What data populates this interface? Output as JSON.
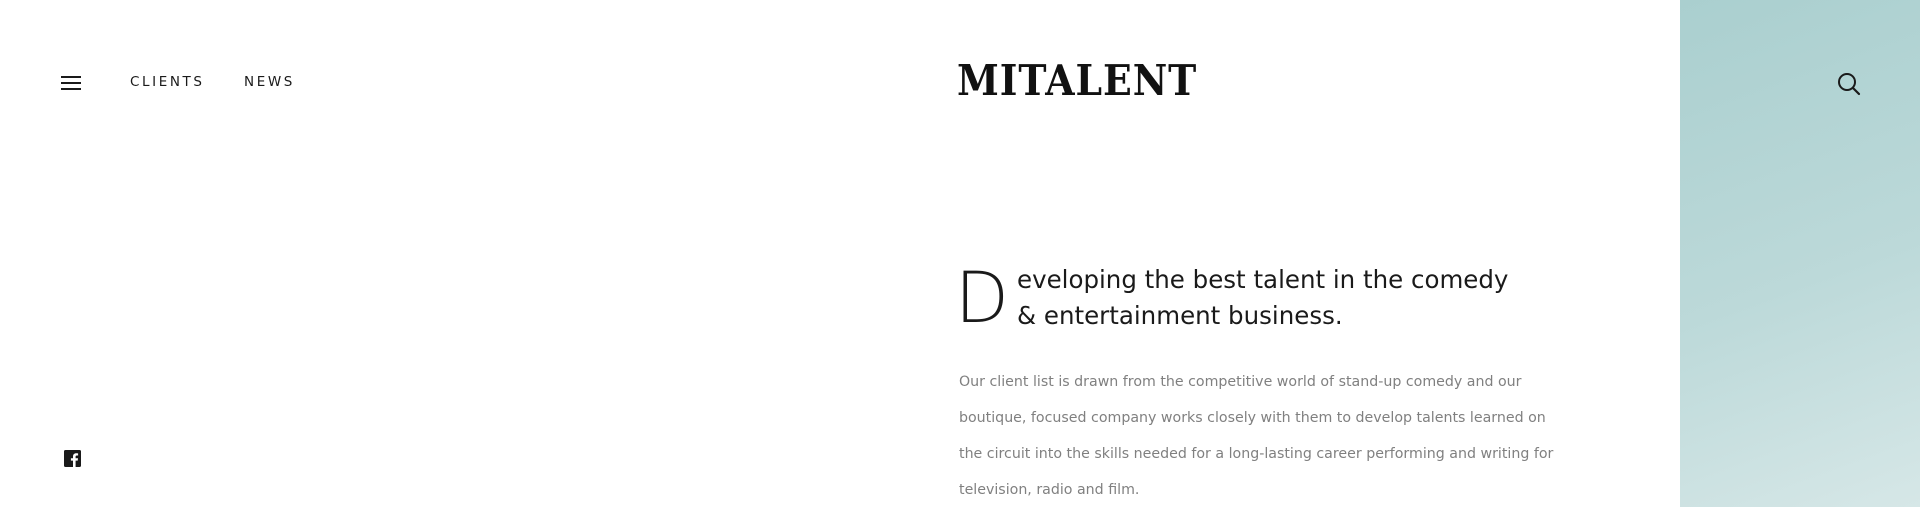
{
  "header": {
    "menu_icon": "hamburger-icon",
    "nav": [
      {
        "label": "CLIENTS"
      },
      {
        "label": "NEWS"
      }
    ],
    "logo": "MITALENT",
    "search_icon": "search-icon"
  },
  "hero": {
    "drop_cap": "D",
    "headline_rest": "eveloping the best talent in the comedy & entertainment business.",
    "body": "Our client list is drawn from the competitive world of stand-up comedy and our boutique, focused company works closely with them to develop talents learned on the circuit into the skills needed for a long-lasting career performing and writing for television, radio and film."
  },
  "social": {
    "facebook_icon": "facebook-icon"
  },
  "colors": {
    "accent_panel": "#aacfcf",
    "text_dark": "#1a1a1a",
    "text_muted": "#808080"
  }
}
